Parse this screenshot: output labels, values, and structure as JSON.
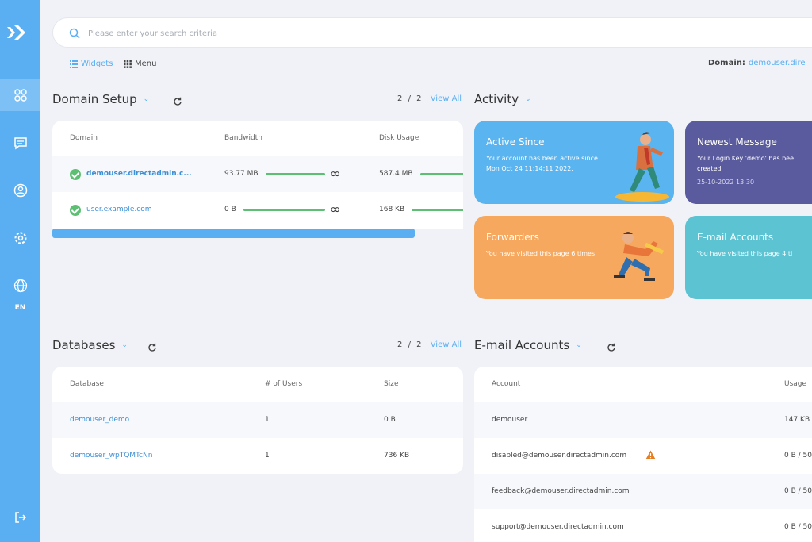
{
  "search": {
    "placeholder": "Please enter your search criteria"
  },
  "view_tabs": {
    "widgets": "Widgets",
    "menu": "Menu"
  },
  "domain_selector": {
    "label": "Domain:",
    "value": "demouser.dire"
  },
  "sidebar": {
    "lang": "EN"
  },
  "domain_setup": {
    "title": "Domain Setup",
    "pager": {
      "current": "2",
      "sep": "/",
      "total": "2",
      "view_all": "View All"
    },
    "columns": [
      "Domain",
      "Bandwidth",
      "Disk Usage"
    ],
    "rows": [
      {
        "domain": "demouser.directadmin.c...",
        "bandwidth": "93.77 MB",
        "bandwidth_frac": 1.0,
        "disk": "587.4 MB"
      },
      {
        "domain": "user.example.com",
        "bandwidth": "0 B",
        "bandwidth_frac": 1.0,
        "disk": "168 KB"
      }
    ]
  },
  "activity": {
    "title": "Activity",
    "tiles": [
      {
        "title": "Active Since",
        "line1": "Your account has been active since",
        "line2": "Mon Oct 24 11:14:11 2022.",
        "color": "#5ab4f0"
      },
      {
        "title": "Newest Message",
        "line1": "Your Login Key 'demo' has bee",
        "line2": "created",
        "date": "25-10-2022 13:30",
        "color": "#5a5a9f"
      },
      {
        "title": "Forwarders",
        "line1": "You have visited this page 6 times",
        "color": "#f6a85e"
      },
      {
        "title": "E-mail Accounts",
        "line1": "You have visited this page 4 ti",
        "color": "#5cc3d3"
      }
    ]
  },
  "databases": {
    "title": "Databases",
    "pager": {
      "current": "2",
      "sep": "/",
      "total": "2",
      "view_all": "View All"
    },
    "columns": [
      "Database",
      "# of Users",
      "Size"
    ],
    "rows": [
      {
        "name": "demouser_demo",
        "users": "1",
        "size": "0 B"
      },
      {
        "name": "demouser_wpTQMTcNn",
        "users": "1",
        "size": "736 KB"
      }
    ]
  },
  "email_accounts": {
    "title": "E-mail Accounts",
    "columns": [
      "Account",
      "Usage"
    ],
    "rows": [
      {
        "account": "demouser",
        "usage": "147 KB"
      },
      {
        "account": "disabled@demouser.directadmin.com",
        "usage": "0 B / 50"
      },
      {
        "account": "feedback@demouser.directadmin.com",
        "usage": "0 B / 50"
      },
      {
        "account": "support@demouser.directadmin.com",
        "usage": "0 B / 50"
      }
    ]
  },
  "colors": {
    "accent": "#5aaff2",
    "success": "#5cbf72",
    "warning": "#e67e22"
  }
}
